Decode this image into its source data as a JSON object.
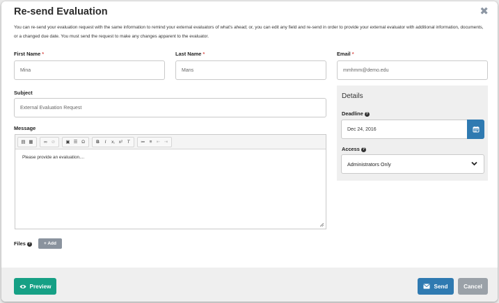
{
  "modal": {
    "title": "Re-send Evaluation",
    "close_glyph": "✖",
    "description": "You can re-send your evaluation request with the same information to remind your external evaluators of what's ahead; or, you can edit any field and re-send in order to provide your external evaluator with additional information, documents, or a changed due date. You must send the request to make any changes apparent to the evaluator."
  },
  "form": {
    "first_name": {
      "label": "First Name",
      "value": "Mina"
    },
    "last_name": {
      "label": "Last Name",
      "value": "Mans"
    },
    "email": {
      "label": "Email",
      "value": "mmhmm@demo.edu"
    },
    "subject": {
      "label": "Subject",
      "value": "External Evaluation Request"
    },
    "message": {
      "label": "Message",
      "value": "Please provide an evaluation...."
    },
    "files": {
      "label": "Files",
      "add_label": "+ Add"
    },
    "required_marker": "*"
  },
  "details": {
    "title": "Details",
    "deadline": {
      "label": "Deadline",
      "value": "Dec 24, 2016"
    },
    "access": {
      "label": "Access",
      "value": "Administrators Only"
    }
  },
  "footer": {
    "preview_label": "Preview",
    "send_label": "Send",
    "cancel_label": "Cancel"
  },
  "colors": {
    "preview": "#16a085",
    "send": "#2f7ab1",
    "cancel": "#9aa1a8",
    "required": "#d9534f"
  },
  "icons": [
    "close-icon",
    "help-icon",
    "calendar-icon",
    "chevron-down-icon",
    "eye-icon",
    "envelope-icon",
    "resize-icon"
  ]
}
